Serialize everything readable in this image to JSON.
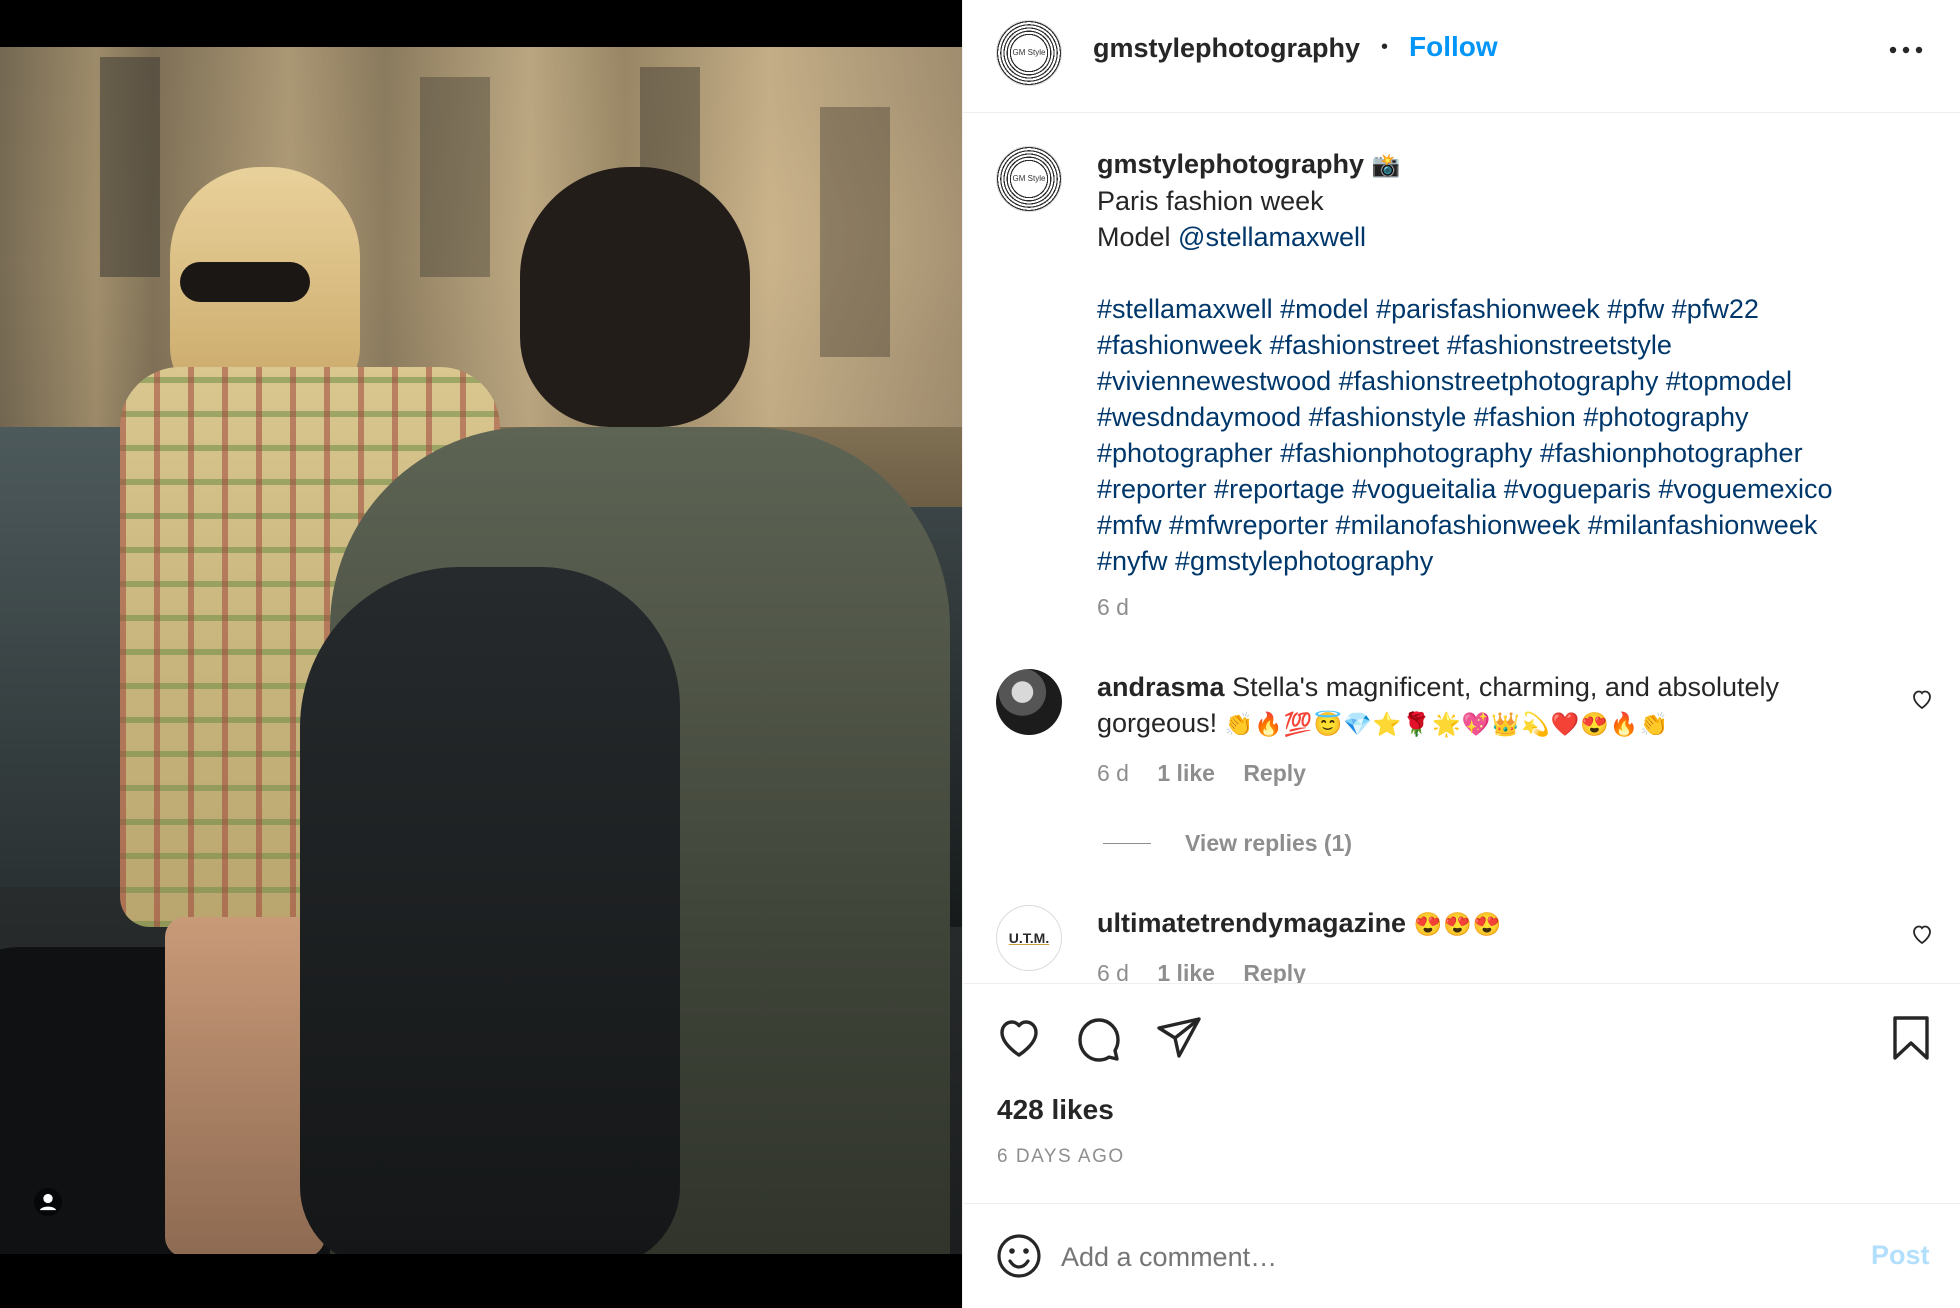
{
  "post": {
    "author": "gmstylephotography",
    "avatar_text": "GM Style",
    "dot": "•",
    "follow_label": "Follow",
    "more_label": "•••"
  },
  "caption": {
    "author": "gmstylephotography",
    "author_emoji": "📸",
    "line1": "Paris fashion week",
    "model_prefix": "Model ",
    "model_mention": "@stellamaxwell",
    "hashtag_lines": [
      "#stellamaxwell #model #parisfashionweek #pfw #pfw22",
      "#fashionweek #fashionstreet #fashionstreetstyle",
      "#viviennewestwood #fashionstreetphotography #topmodel",
      "#wesdndaymood #fashionstyle #fashion #photography",
      "#photographer #fashionphotography #fashionphotographer",
      "#reporter #reportage #vogueitalia #vogueparis #voguemexico",
      "#mfw #mfwreporter #milanofashionweek #milanfashionweek",
      "#nyfw #gmstylephotography"
    ],
    "age": "6 d"
  },
  "comments": [
    {
      "user": "andrasma",
      "text_line1": " Stella's magnificent, charming, and absolutely",
      "text_line2": "gorgeous! ",
      "emojis": "👏🔥💯😇💎⭐🌹🌟💖👑💫❤️😍🔥👏",
      "age": "6 d",
      "likes": "1 like",
      "reply_label": "Reply",
      "view_replies": "View replies (1)"
    },
    {
      "user": "ultimatetrendymagazine",
      "avatar_text": "U.T.M.",
      "emojis": "😍😍😍",
      "age": "6 d",
      "likes": "1 like",
      "reply_label": "Reply"
    }
  ],
  "actions": {
    "likes_count": "428 likes",
    "date": "6 DAYS AGO"
  },
  "composer": {
    "placeholder": "Add a comment…",
    "post_label": "Post"
  },
  "colors": {
    "link": "#00376b",
    "follow": "#0095f6",
    "muted": "#8e8e8e",
    "post_disabled": "#b2dffc",
    "heart_red": "#ed4956"
  },
  "icons": [
    "heart-icon",
    "comment-icon",
    "share-icon",
    "bookmark-icon",
    "emoji-icon",
    "more-icon",
    "user-tag-icon"
  ]
}
